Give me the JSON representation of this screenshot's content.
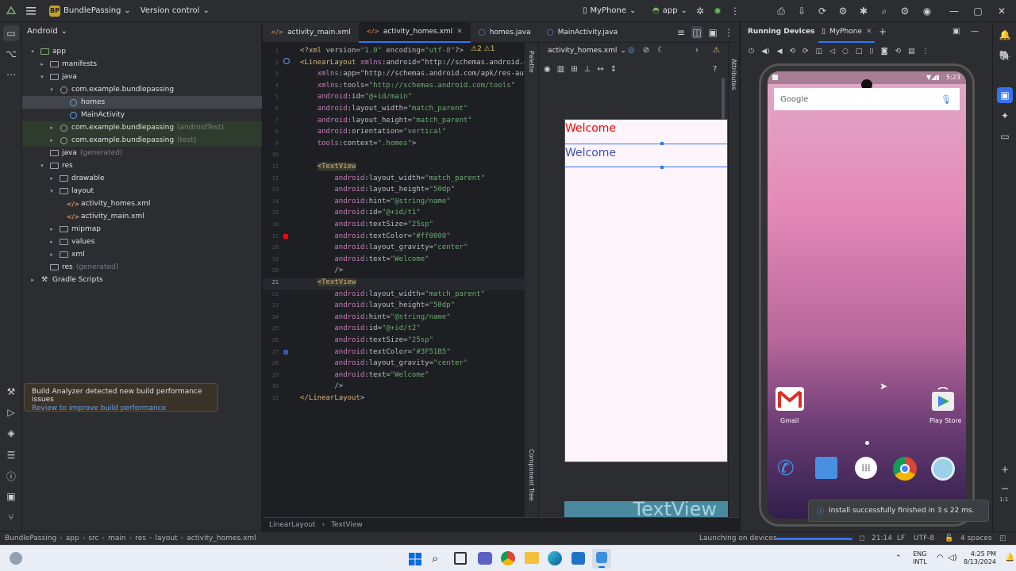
{
  "titlebar": {
    "project_badge": "BP",
    "project_name": "BundlePassing",
    "vcs": "Version control",
    "device": "MyPhone",
    "run_config": "app"
  },
  "project_panel": {
    "view_mode": "Android",
    "tree": [
      {
        "label": "app",
        "indent": 0,
        "kind": "module",
        "arrow": "▾"
      },
      {
        "label": "manifests",
        "indent": 1,
        "kind": "folder",
        "arrow": "▸"
      },
      {
        "label": "java",
        "indent": 1,
        "kind": "folder",
        "arrow": "▾"
      },
      {
        "label": "com.example.bundlepassing",
        "indent": 2,
        "kind": "pkg",
        "arrow": "▾"
      },
      {
        "label": "homes",
        "indent": 3,
        "kind": "class",
        "arrow": "",
        "selected": true
      },
      {
        "label": "MainActivity",
        "indent": 3,
        "kind": "class",
        "arrow": ""
      },
      {
        "label": "com.example.bundlepassing",
        "suffix": "(androidTest)",
        "indent": 2,
        "kind": "pkg",
        "arrow": "▸",
        "hl": true
      },
      {
        "label": "com.example.bundlepassing",
        "suffix": "(test)",
        "indent": 2,
        "kind": "pkg",
        "arrow": "▸",
        "hl": true
      },
      {
        "label": "java",
        "suffix": "(generated)",
        "indent": 1,
        "kind": "folder",
        "arrow": ""
      },
      {
        "label": "res",
        "indent": 1,
        "kind": "folder",
        "arrow": "▾"
      },
      {
        "label": "drawable",
        "indent": 2,
        "kind": "folder",
        "arrow": "▸"
      },
      {
        "label": "layout",
        "indent": 2,
        "kind": "folder",
        "arrow": "▾"
      },
      {
        "label": "activity_homes.xml",
        "indent": 3,
        "kind": "xml",
        "arrow": ""
      },
      {
        "label": "activity_main.xml",
        "indent": 3,
        "kind": "xml",
        "arrow": ""
      },
      {
        "label": "mipmap",
        "indent": 2,
        "kind": "folder",
        "arrow": "▸"
      },
      {
        "label": "values",
        "indent": 2,
        "kind": "folder",
        "arrow": "▸"
      },
      {
        "label": "xml",
        "indent": 2,
        "kind": "folder",
        "arrow": "▸"
      },
      {
        "label": "res",
        "suffix": "(generated)",
        "indent": 1,
        "kind": "folder",
        "arrow": ""
      },
      {
        "label": "Gradle Scripts",
        "indent": 0,
        "kind": "gradle",
        "arrow": "▸"
      }
    ]
  },
  "notification": {
    "title": "Build Analyzer detected new build performance issues",
    "link": "Review to improve build performance"
  },
  "tabs": [
    {
      "label": "activity_main.xml",
      "kind": "xml"
    },
    {
      "label": "activity_homes.xml",
      "kind": "xml",
      "active": true
    },
    {
      "label": "homes.java",
      "kind": "class"
    },
    {
      "label": "MainActivity.java",
      "kind": "class"
    }
  ],
  "editor": {
    "problems": "⚠2  ⚠1",
    "lines": [
      "<?xml version=\"1.0\" encoding=\"utf-8\"?>",
      "<LinearLayout xmlns:android=\"http://schemas.android.c",
      "    xmlns:app=\"http://schemas.android.com/apk/res-aut",
      "    xmlns:tools=\"http://schemas.android.com/tools\"",
      "    android:id=\"@+id/main\"",
      "    android:layout_width=\"match_parent\"",
      "    android:layout_height=\"match_parent\"",
      "    android:orientation=\"vertical\"",
      "    tools:context=\".homes\">",
      "",
      "    <TextView",
      "        android:layout_width=\"match_parent\"",
      "        android:layout_height=\"50dp\"",
      "        android:hint=\"@string/name\"",
      "        android:id=\"@+id/t1\"",
      "        android:textSize=\"25sp\"",
      "        android:textColor=\"#ff0000\"",
      "        android:layout_gravity=\"center\"",
      "        android:text=\"Welcome\"",
      "        />",
      "    <TextView",
      "        android:layout_width=\"match_parent\"",
      "        android:layout_height=\"50dp\"",
      "        android:hint=\"@string/name\"",
      "        android:id=\"@+id/t2\"",
      "        android:textSize=\"25sp\"",
      "        android:textColor=\"#3F51B5\"",
      "        android:layout_gravity=\"center\"",
      "        android:text=\"Welcome\"",
      "        />",
      "</LinearLayout>"
    ],
    "current_line": "21"
  },
  "design": {
    "file_dropdown": "activity_homes.xml",
    "palette_label": "Palette",
    "component_tree_label": "Component Tree",
    "attributes_label": "Attributes",
    "text1": "Welcome",
    "text1_color": "#ff0000",
    "text2": "Welcome",
    "text2_color": "#3F51B5",
    "preview_label": "TextView"
  },
  "devices": {
    "title": "Running Devices",
    "tab": "MyPhone",
    "clock": "5:23",
    "google": "Google",
    "apps": [
      "Gmail",
      "Play Store"
    ],
    "toast": "Install successfully finished in 3 s 22 ms."
  },
  "breadcrumb_editor": [
    "LinearLayout",
    "TextView"
  ],
  "statusbar": {
    "path": [
      "BundlePassing",
      "app",
      "src",
      "main",
      "res",
      "layout",
      "activity_homes.xml"
    ],
    "task": "Launching on devices",
    "position": "21:14",
    "line_sep": "LF",
    "encoding": "UTF-8",
    "indent": "4 spaces"
  },
  "taskbar": {
    "lang1": "ENG",
    "lang2": "INTL",
    "time": "4:25 PM",
    "date": "8/13/2024"
  }
}
